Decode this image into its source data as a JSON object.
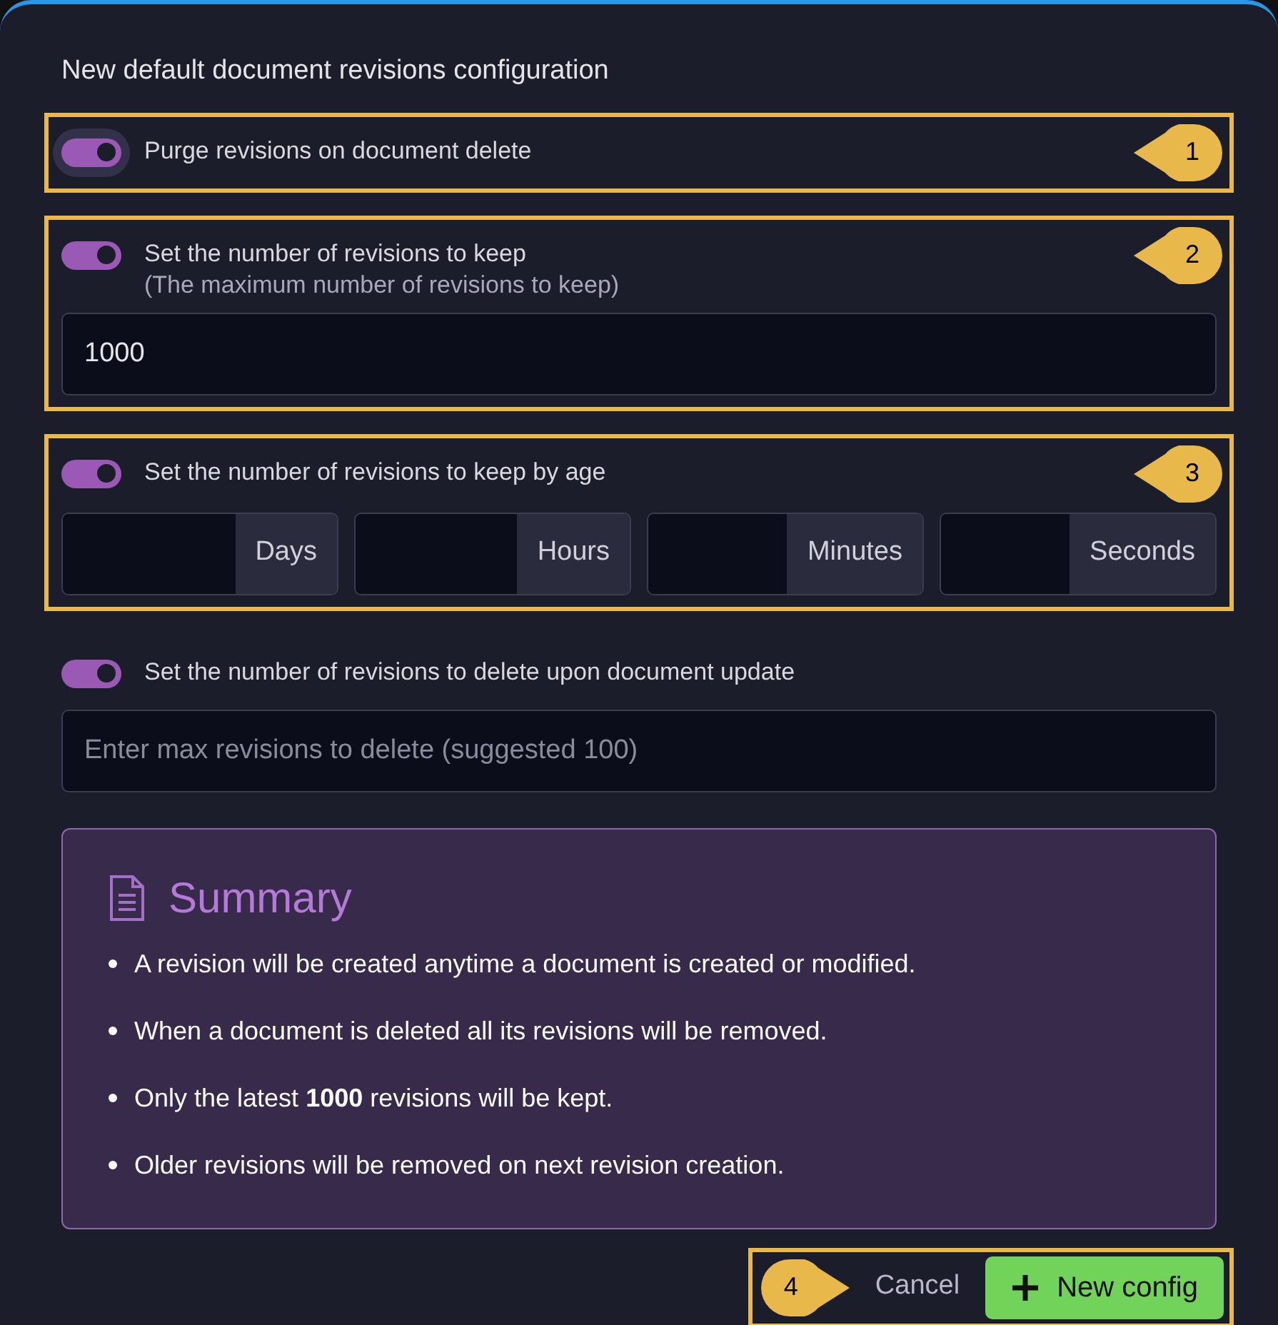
{
  "title": "New default document revisions configuration",
  "options": [
    {
      "kind": "toggle",
      "label": "Purge revisions on document delete",
      "on": true,
      "focused": true,
      "callout": "1"
    },
    {
      "kind": "input",
      "label": "Set the number of revisions to keep",
      "sublabel": "(The maximum number of revisions to keep)",
      "on": true,
      "focused": false,
      "value": "1000",
      "callout": "2"
    },
    {
      "kind": "duration",
      "label": "Set the number of revisions to keep by age",
      "on": true,
      "focused": false,
      "units": [
        "Days",
        "Hours",
        "Minutes",
        "Seconds"
      ],
      "callout": "3"
    },
    {
      "kind": "input",
      "label": "Set the number of revisions to delete upon document update",
      "on": true,
      "focused": false,
      "placeholder": "Enter max revisions to delete (suggested 100)"
    }
  ],
  "summary": {
    "title": "Summary",
    "items": [
      "A revision will be created anytime a document is created or modified.",
      "When a document is deleted all its revisions will be removed.",
      "Only the latest **1000** revisions will be kept.",
      "Older revisions will be removed on next revision creation."
    ]
  },
  "actions": {
    "callout": "4",
    "cancel": "Cancel",
    "submit": "New config"
  }
}
